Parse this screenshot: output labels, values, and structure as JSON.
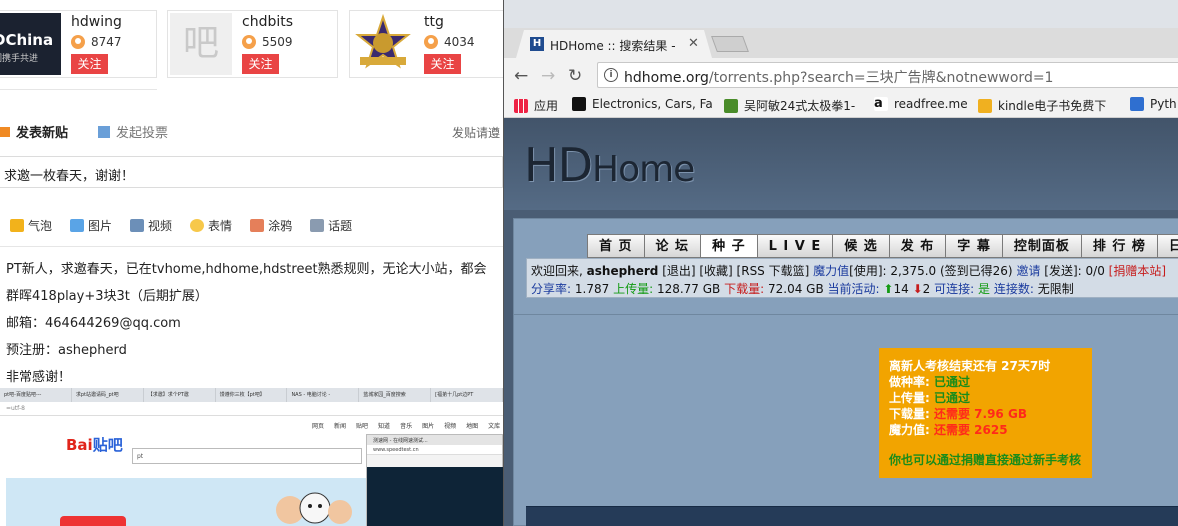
{
  "users": [
    {
      "name": "hdwing",
      "count": "8747",
      "follow": "关注",
      "avatar_text": "DChina",
      "avatar_sub": "们携手共进"
    },
    {
      "name": "chdbits",
      "count": "5509",
      "follow": "关注",
      "avatar_text": "吧"
    },
    {
      "name": "ttg",
      "count": "4034",
      "follow": "关注"
    }
  ],
  "post": {
    "new_post": "发表新贴",
    "vote": "发起投票",
    "hint": "发贴请遵",
    "title": "求邀一枚春天，谢谢！",
    "toolbar": [
      "气泡",
      "图片",
      "视频",
      "表情",
      "涂鸦",
      "话题"
    ],
    "lines": [
      "PT新人，求邀春天，已在tvhome,hdhome,hdstreet熟悉规则，无论大小站，都会",
      "群晖418play+3块3t（后期扩展）",
      "邮箱：464644269@qq.com",
      "预注册：ashepherd",
      "非常感谢！"
    ]
  },
  "mini": {
    "tabs": [
      "pt吧-百度贴吧---",
      "求pt站邀请码_pt吧",
      "【求邀】求个PT邀",
      "馒遵你三枚【pt吧】",
      "NAS - 电脑讨论 -",
      "蓝城家园_百度搜索",
      "[福弟十几pt边PT"
    ],
    "addr": "=utf-8",
    "nav": [
      "网页",
      "新闻",
      "贴吧",
      "知道",
      "音乐",
      "图片",
      "视频",
      "地图",
      "文库"
    ],
    "logo": "Bai",
    "logo2": "贴吧",
    "search": "pt",
    "popup_title": "测速网 - 在线网速测试...",
    "popup_addr": "www.speedtest.cn"
  },
  "browser": {
    "tab_title": "HDHome :: 搜索结果 - 三",
    "favicon": "H",
    "url_host": "hdhome.org",
    "url_path": "/torrents.php?search=三块广告牌&notnewword=1",
    "bookmarks": [
      "应用",
      "Electronics, Cars, Fa",
      "吴阿敏24式太极拳1-",
      "readfree.me",
      "kindle电子书免费下",
      "Pyth"
    ]
  },
  "site": {
    "logo_a": "HD",
    "logo_b": "Home",
    "menu": [
      "首 页",
      "论 坛",
      "种 子",
      "L I V E",
      "候 选",
      "发 布",
      "字 幕",
      "控制面板",
      "排 行 榜",
      "日"
    ],
    "active_menu": "种 子",
    "info": {
      "welcome": "欢迎回来,",
      "user": "ashepherd",
      "links": "[退出] [收藏] [RSS 下载篮]",
      "magic_label": "魔力值",
      "magic_text": "[使用]: 2,375.0 (签到已得26)",
      "invite": "邀请",
      "sent": "[发送]: 0/0",
      "donate": "[捐赠本站]",
      "ratio_label": "分享率:",
      "ratio": "1.787",
      "up_label": "上传量:",
      "up": "128.77 GB",
      "down_label": "下载量:",
      "down": "72.04 GB",
      "active_label": "当前活动:",
      "seeding": "14",
      "leeching": "2",
      "connectable_label": "可连接:",
      "connectable": "是",
      "connections_label": "连接数:",
      "connections": "无限制"
    },
    "notice": {
      "title": "离新人考核结束还有 27天7时",
      "rows": [
        {
          "label": "做种率:",
          "value": "已通过",
          "ok": true
        },
        {
          "label": "上传量:",
          "value": "已通过",
          "ok": true
        },
        {
          "label": "下载量:",
          "value": "还需要 7.96 GB",
          "ok": false
        },
        {
          "label": "魔力值:",
          "value": "还需要 2625",
          "ok": false
        }
      ],
      "footer": "你也可以通过捐赠直接通过新手考核"
    }
  },
  "colors": {
    "follow": "#e94444",
    "notice_bg": "#f2a400",
    "site_bg": "#4a5d74"
  }
}
